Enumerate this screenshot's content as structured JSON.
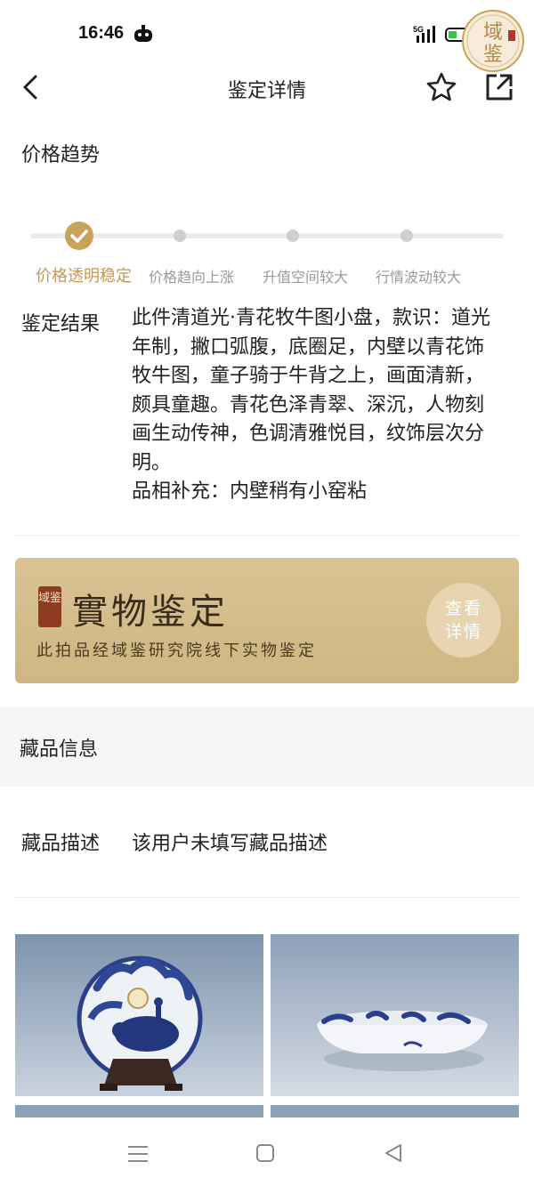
{
  "status": {
    "time": "16:46",
    "network": "5G"
  },
  "header": {
    "title": "鉴定详情"
  },
  "trend": {
    "title": "价格趋势",
    "steps": [
      {
        "label": "价格透明稳定",
        "active": true
      },
      {
        "label": "价格趋向上涨",
        "active": false
      },
      {
        "label": "升值空间较大",
        "active": false
      },
      {
        "label": "行情波动较大",
        "active": false
      }
    ]
  },
  "result": {
    "label": "鉴定结果",
    "text": "此件清道光·青花牧牛图小盘，款识：道光年制，撇口弧腹，底圈足，内壁以青花饰牧牛图，童子骑于牛背之上，画面清新，颇具童趣。青花色泽青翠、深沉，人物刻画生动传神，色调清雅悦目，纹饰层次分明。",
    "supplement": "品相补充：内壁稍有小窑粘"
  },
  "banner": {
    "seal_text": "域鉴",
    "title": "實物鉴定",
    "subtitle": "此拍品经域鉴研究院线下实物鉴定",
    "button_line1": "查看",
    "button_line2": "详情"
  },
  "logo": {
    "text": "域鉴"
  },
  "collection": {
    "info_title": "藏品信息",
    "desc_label": "藏品描述",
    "desc_text": "该用户未填写藏品描述"
  },
  "colors": {
    "accent": "#c9a35a",
    "banner": "#d4bd8b"
  }
}
